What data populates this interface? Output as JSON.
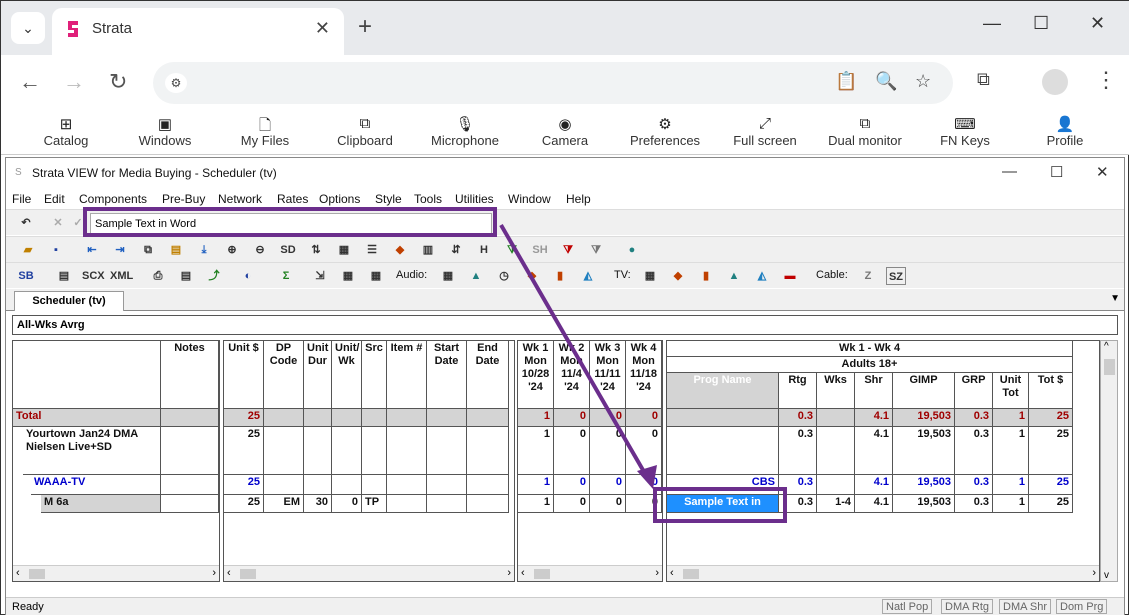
{
  "browser": {
    "tab_title": "Strata",
    "toolbar": [
      {
        "icon": "plus-square-icon",
        "glyph": "⊞",
        "label": "Catalog"
      },
      {
        "icon": "window-icon",
        "glyph": "▣",
        "label": "Windows"
      },
      {
        "icon": "file-icon",
        "glyph": "🗋",
        "label": "My Files"
      },
      {
        "icon": "clipboard-icon",
        "glyph": "⧉",
        "label": "Clipboard"
      },
      {
        "icon": "microphone-off-icon",
        "glyph": "🎙",
        "label": "Microphone"
      },
      {
        "icon": "camera-icon",
        "glyph": "◉",
        "label": "Camera"
      },
      {
        "icon": "gear-icon",
        "glyph": "⚙",
        "label": "Preferences"
      },
      {
        "icon": "fullscreen-icon",
        "glyph": "⤢",
        "label": "Full screen"
      },
      {
        "icon": "dual-monitor-icon",
        "glyph": "⧉",
        "label": "Dual monitor"
      },
      {
        "icon": "keyboard-icon",
        "glyph": "⌨",
        "label": "FN Keys"
      },
      {
        "icon": "person-icon",
        "glyph": "👤",
        "label": "Profile"
      }
    ]
  },
  "app": {
    "title": "Strata VIEW for Media Buying - Scheduler (tv)",
    "menu": [
      "File",
      "Edit",
      "Components",
      "Pre-Buy",
      "Network",
      "Rates",
      "Options",
      "Style",
      "Tools",
      "Utilities",
      "Window",
      "Help"
    ],
    "edit_value": "Sample Text in Word",
    "toolbar3_labels": {
      "audio": "Audio:",
      "tv": "TV:",
      "cable": "Cable:"
    },
    "icon_text": {
      "sb": "SB",
      "scx": "SCX",
      "xml": "XML",
      "sh": "SH",
      "hcap": "H"
    },
    "doc_tab": "Scheduler (tv)",
    "avg_label": "All-Wks Avrg",
    "status": {
      "ready": "Ready",
      "panels": [
        "Natl Pop",
        "DMA Rtg",
        "DMA Shr",
        "Dom Prg"
      ]
    }
  },
  "grid": {
    "left_headers": {
      "notes": "Notes"
    },
    "mid_headers": [
      "Unit $",
      "DP Code",
      "Unit Dur",
      "Unit/ Wk",
      "Src",
      "Item #",
      "Start Date",
      "End Date"
    ],
    "week_headers": [
      "Wk 1 Mon 10/28 '24",
      "Wk 2 Mon 11/4 '24",
      "Wk 3 Mon 11/11 '24",
      "Wk 4 Mon 11/18 '24"
    ],
    "right_top": "Wk 1 - Wk 4",
    "right_demo": "Adults 18+",
    "right_headers": [
      "Prog Name",
      "Rtg",
      "Wks",
      "Shr",
      "GIMP",
      "GRP",
      "Unit Tot",
      "Tot $"
    ],
    "rows": [
      {
        "name": "Total",
        "unit": "25",
        "dp": "",
        "dur": "",
        "uw": "",
        "src": "",
        "weeks": [
          "1",
          "0",
          "0",
          "0"
        ],
        "prog": "",
        "rtg": "0.3",
        "wks": "",
        "shr": "4.1",
        "gimp": "19,503",
        "grp": "0.3",
        "ut": "1",
        "tot": "25"
      },
      {
        "name": "Yourtown Jan24 DMA Nielsen Live+SD",
        "unit": "25",
        "dp": "",
        "dur": "",
        "uw": "",
        "src": "",
        "weeks": [
          "1",
          "0",
          "0",
          "0"
        ],
        "prog": "",
        "rtg": "0.3",
        "wks": "",
        "shr": "4.1",
        "gimp": "19,503",
        "grp": "0.3",
        "ut": "1",
        "tot": "25"
      },
      {
        "name": "WAAA-TV",
        "unit": "25",
        "dp": "",
        "dur": "",
        "uw": "",
        "src": "",
        "weeks": [
          "1",
          "0",
          "0",
          "0"
        ],
        "prog": "CBS",
        "rtg": "0.3",
        "wks": "",
        "shr": "4.1",
        "gimp": "19,503",
        "grp": "0.3",
        "ut": "1",
        "tot": "25"
      },
      {
        "name": "M 6a",
        "unit": "25",
        "dp": "EM",
        "dur": "30",
        "uw": "0",
        "src": "TP",
        "weeks": [
          "1",
          "0",
          "0",
          "0"
        ],
        "prog": "Sample Text in",
        "rtg": "0.3",
        "wks": "1-4",
        "shr": "4.1",
        "gimp": "19,503",
        "grp": "0.3",
        "ut": "1",
        "tot": "25"
      }
    ]
  },
  "colors": {
    "annotation": "#6b2e8c",
    "selection": "#1e90ff",
    "accent_red": "#a00000",
    "accent_blue": "#0000cc"
  }
}
